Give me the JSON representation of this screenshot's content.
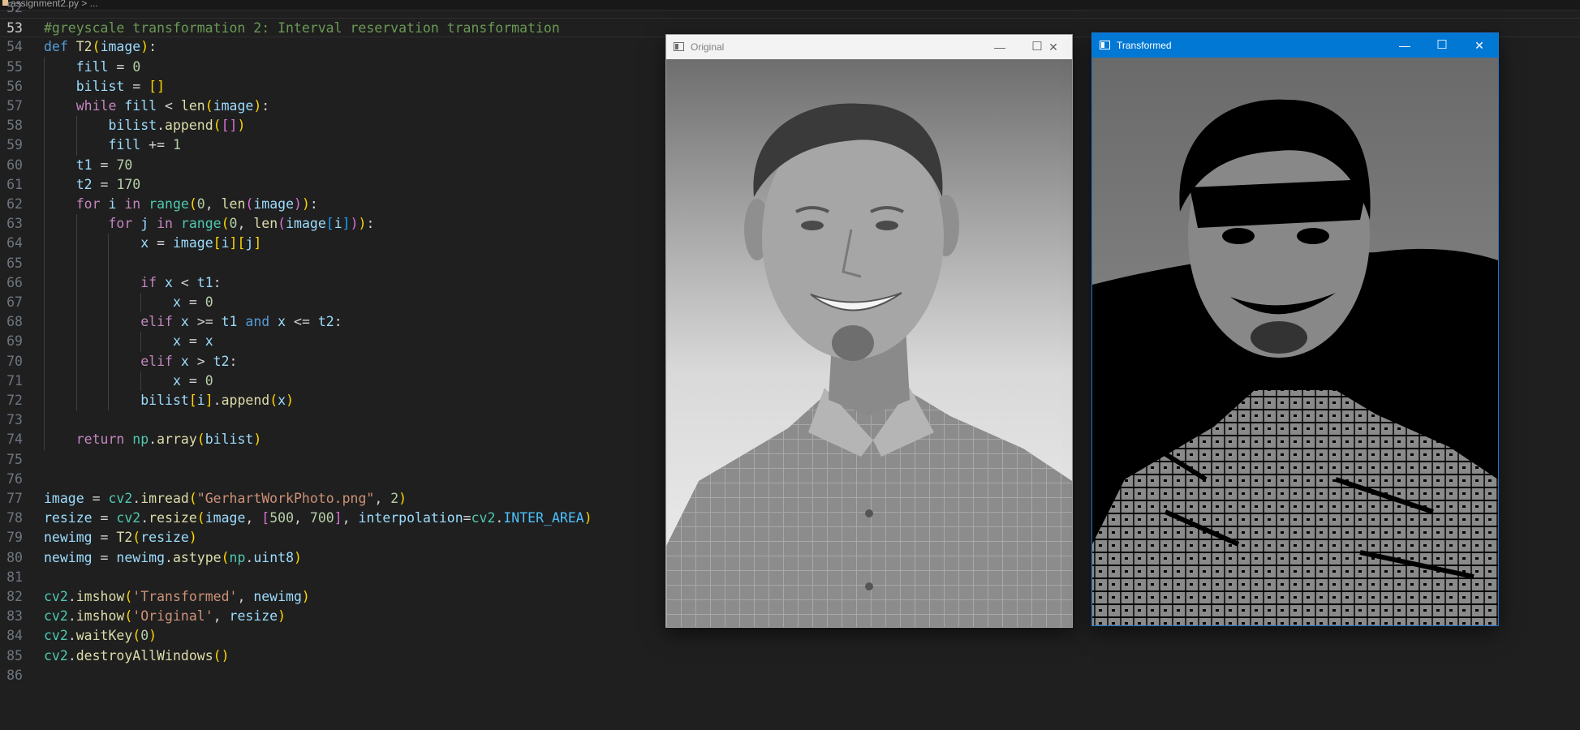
{
  "breadcrumb": {
    "file": "assignment2.py > ..."
  },
  "editor": {
    "current_line": "53",
    "lines": [
      {
        "n": "52",
        "tokens": []
      },
      {
        "n": "53",
        "tokens": [
          {
            "t": "#greyscale transformation 2: Interval reservation transformation",
            "c": "cm"
          }
        ]
      },
      {
        "n": "54",
        "tokens": [
          {
            "t": "def",
            "c": "kw"
          },
          {
            "t": " "
          },
          {
            "t": "T2",
            "c": "fn"
          },
          {
            "t": "(",
            "c": "b1"
          },
          {
            "t": "image",
            "c": "vr"
          },
          {
            "t": ")",
            "c": "b1"
          },
          {
            "t": ":"
          }
        ]
      },
      {
        "n": "55",
        "tokens": [
          {
            "t": "    "
          },
          {
            "t": "fill",
            "c": "vr"
          },
          {
            "t": " = "
          },
          {
            "t": "0",
            "c": "nm"
          }
        ]
      },
      {
        "n": "56",
        "tokens": [
          {
            "t": "    "
          },
          {
            "t": "bilist",
            "c": "vr"
          },
          {
            "t": " = "
          },
          {
            "t": "[]",
            "c": "b1"
          }
        ]
      },
      {
        "n": "57",
        "tokens": [
          {
            "t": "    "
          },
          {
            "t": "while",
            "c": "ctl"
          },
          {
            "t": " "
          },
          {
            "t": "fill",
            "c": "vr"
          },
          {
            "t": " < "
          },
          {
            "t": "len",
            "c": "fn"
          },
          {
            "t": "(",
            "c": "b1"
          },
          {
            "t": "image",
            "c": "vr"
          },
          {
            "t": ")",
            "c": "b1"
          },
          {
            "t": ":"
          }
        ]
      },
      {
        "n": "58",
        "tokens": [
          {
            "t": "        "
          },
          {
            "t": "bilist",
            "c": "vr"
          },
          {
            "t": "."
          },
          {
            "t": "append",
            "c": "fn"
          },
          {
            "t": "(",
            "c": "b1"
          },
          {
            "t": "[]",
            "c": "b2"
          },
          {
            "t": ")",
            "c": "b1"
          }
        ]
      },
      {
        "n": "59",
        "tokens": [
          {
            "t": "        "
          },
          {
            "t": "fill",
            "c": "vr"
          },
          {
            "t": " += "
          },
          {
            "t": "1",
            "c": "nm"
          }
        ]
      },
      {
        "n": "60",
        "tokens": [
          {
            "t": "    "
          },
          {
            "t": "t1",
            "c": "vr"
          },
          {
            "t": " = "
          },
          {
            "t": "70",
            "c": "nm"
          }
        ]
      },
      {
        "n": "61",
        "tokens": [
          {
            "t": "    "
          },
          {
            "t": "t2",
            "c": "vr"
          },
          {
            "t": " = "
          },
          {
            "t": "170",
            "c": "nm"
          }
        ]
      },
      {
        "n": "62",
        "tokens": [
          {
            "t": "    "
          },
          {
            "t": "for",
            "c": "ctl"
          },
          {
            "t": " "
          },
          {
            "t": "i",
            "c": "vr"
          },
          {
            "t": " "
          },
          {
            "t": "in",
            "c": "ctl"
          },
          {
            "t": " "
          },
          {
            "t": "range",
            "c": "md"
          },
          {
            "t": "(",
            "c": "b1"
          },
          {
            "t": "0",
            "c": "nm"
          },
          {
            "t": ", "
          },
          {
            "t": "len",
            "c": "fn"
          },
          {
            "t": "(",
            "c": "b2"
          },
          {
            "t": "image",
            "c": "vr"
          },
          {
            "t": ")",
            "c": "b2"
          },
          {
            "t": ")",
            "c": "b1"
          },
          {
            "t": ":"
          }
        ]
      },
      {
        "n": "63",
        "tokens": [
          {
            "t": "        "
          },
          {
            "t": "for",
            "c": "ctl"
          },
          {
            "t": " "
          },
          {
            "t": "j",
            "c": "vr"
          },
          {
            "t": " "
          },
          {
            "t": "in",
            "c": "ctl"
          },
          {
            "t": " "
          },
          {
            "t": "range",
            "c": "md"
          },
          {
            "t": "(",
            "c": "b1"
          },
          {
            "t": "0",
            "c": "nm"
          },
          {
            "t": ", "
          },
          {
            "t": "len",
            "c": "fn"
          },
          {
            "t": "(",
            "c": "b2"
          },
          {
            "t": "image",
            "c": "vr"
          },
          {
            "t": "[",
            "c": "b3"
          },
          {
            "t": "i",
            "c": "vr"
          },
          {
            "t": "]",
            "c": "b3"
          },
          {
            "t": ")",
            "c": "b2"
          },
          {
            "t": ")",
            "c": "b1"
          },
          {
            "t": ":"
          }
        ]
      },
      {
        "n": "64",
        "tokens": [
          {
            "t": "            "
          },
          {
            "t": "x",
            "c": "vr"
          },
          {
            "t": " = "
          },
          {
            "t": "image",
            "c": "vr"
          },
          {
            "t": "[",
            "c": "b1"
          },
          {
            "t": "i",
            "c": "vr"
          },
          {
            "t": "]",
            "c": "b1"
          },
          {
            "t": "[",
            "c": "b1"
          },
          {
            "t": "j",
            "c": "vr"
          },
          {
            "t": "]",
            "c": "b1"
          }
        ]
      },
      {
        "n": "65",
        "tokens": []
      },
      {
        "n": "66",
        "tokens": [
          {
            "t": "            "
          },
          {
            "t": "if",
            "c": "ctl"
          },
          {
            "t": " "
          },
          {
            "t": "x",
            "c": "vr"
          },
          {
            "t": " < "
          },
          {
            "t": "t1",
            "c": "vr"
          },
          {
            "t": ":"
          }
        ]
      },
      {
        "n": "67",
        "tokens": [
          {
            "t": "                "
          },
          {
            "t": "x",
            "c": "vr"
          },
          {
            "t": " = "
          },
          {
            "t": "0",
            "c": "nm"
          }
        ]
      },
      {
        "n": "68",
        "tokens": [
          {
            "t": "            "
          },
          {
            "t": "elif",
            "c": "ctl"
          },
          {
            "t": " "
          },
          {
            "t": "x",
            "c": "vr"
          },
          {
            "t": " >= "
          },
          {
            "t": "t1",
            "c": "vr"
          },
          {
            "t": " "
          },
          {
            "t": "and",
            "c": "kw"
          },
          {
            "t": " "
          },
          {
            "t": "x",
            "c": "vr"
          },
          {
            "t": " <= "
          },
          {
            "t": "t2",
            "c": "vr"
          },
          {
            "t": ":"
          }
        ]
      },
      {
        "n": "69",
        "tokens": [
          {
            "t": "                "
          },
          {
            "t": "x",
            "c": "vr"
          },
          {
            "t": " = "
          },
          {
            "t": "x",
            "c": "vr"
          }
        ]
      },
      {
        "n": "70",
        "tokens": [
          {
            "t": "            "
          },
          {
            "t": "elif",
            "c": "ctl"
          },
          {
            "t": " "
          },
          {
            "t": "x",
            "c": "vr"
          },
          {
            "t": " > "
          },
          {
            "t": "t2",
            "c": "vr"
          },
          {
            "t": ":"
          }
        ]
      },
      {
        "n": "71",
        "tokens": [
          {
            "t": "                "
          },
          {
            "t": "x",
            "c": "vr"
          },
          {
            "t": " = "
          },
          {
            "t": "0",
            "c": "nm"
          }
        ]
      },
      {
        "n": "72",
        "tokens": [
          {
            "t": "            "
          },
          {
            "t": "bilist",
            "c": "vr"
          },
          {
            "t": "[",
            "c": "b1"
          },
          {
            "t": "i",
            "c": "vr"
          },
          {
            "t": "]",
            "c": "b1"
          },
          {
            "t": "."
          },
          {
            "t": "append",
            "c": "fn"
          },
          {
            "t": "(",
            "c": "b1"
          },
          {
            "t": "x",
            "c": "vr"
          },
          {
            "t": ")",
            "c": "b1"
          }
        ]
      },
      {
        "n": "73",
        "tokens": []
      },
      {
        "n": "74",
        "tokens": [
          {
            "t": "    "
          },
          {
            "t": "return",
            "c": "ctl"
          },
          {
            "t": " "
          },
          {
            "t": "np",
            "c": "md"
          },
          {
            "t": "."
          },
          {
            "t": "array",
            "c": "fn"
          },
          {
            "t": "(",
            "c": "b1"
          },
          {
            "t": "bilist",
            "c": "vr"
          },
          {
            "t": ")",
            "c": "b1"
          }
        ]
      },
      {
        "n": "75",
        "tokens": []
      },
      {
        "n": "76",
        "tokens": []
      },
      {
        "n": "77",
        "tokens": [
          {
            "t": "image",
            "c": "vr"
          },
          {
            "t": " = "
          },
          {
            "t": "cv2",
            "c": "md"
          },
          {
            "t": "."
          },
          {
            "t": "imread",
            "c": "fn"
          },
          {
            "t": "(",
            "c": "b1"
          },
          {
            "t": "\"GerhartWorkPhoto.png\"",
            "c": "st"
          },
          {
            "t": ", "
          },
          {
            "t": "2",
            "c": "nm"
          },
          {
            "t": ")",
            "c": "b1"
          }
        ]
      },
      {
        "n": "78",
        "tokens": [
          {
            "t": "resize",
            "c": "vr"
          },
          {
            "t": " = "
          },
          {
            "t": "cv2",
            "c": "md"
          },
          {
            "t": "."
          },
          {
            "t": "resize",
            "c": "fn"
          },
          {
            "t": "(",
            "c": "b1"
          },
          {
            "t": "image",
            "c": "vr"
          },
          {
            "t": ", "
          },
          {
            "t": "[",
            "c": "b2"
          },
          {
            "t": "500",
            "c": "nm"
          },
          {
            "t": ", "
          },
          {
            "t": "700",
            "c": "nm"
          },
          {
            "t": "]",
            "c": "b2"
          },
          {
            "t": ", "
          },
          {
            "t": "interpolation",
            "c": "vr"
          },
          {
            "t": "="
          },
          {
            "t": "cv2",
            "c": "md"
          },
          {
            "t": "."
          },
          {
            "t": "INTER_AREA",
            "c": "cn"
          },
          {
            "t": ")",
            "c": "b1"
          }
        ]
      },
      {
        "n": "79",
        "tokens": [
          {
            "t": "newimg",
            "c": "vr"
          },
          {
            "t": " = "
          },
          {
            "t": "T2",
            "c": "fn"
          },
          {
            "t": "(",
            "c": "b1"
          },
          {
            "t": "resize",
            "c": "vr"
          },
          {
            "t": ")",
            "c": "b1"
          }
        ]
      },
      {
        "n": "80",
        "tokens": [
          {
            "t": "newimg",
            "c": "vr"
          },
          {
            "t": " = "
          },
          {
            "t": "newimg",
            "c": "vr"
          },
          {
            "t": "."
          },
          {
            "t": "astype",
            "c": "fn"
          },
          {
            "t": "(",
            "c": "b1"
          },
          {
            "t": "np",
            "c": "md"
          },
          {
            "t": "."
          },
          {
            "t": "uint8",
            "c": "vr"
          },
          {
            "t": ")",
            "c": "b1"
          }
        ]
      },
      {
        "n": "81",
        "tokens": []
      },
      {
        "n": "82",
        "tokens": [
          {
            "t": "cv2",
            "c": "md"
          },
          {
            "t": "."
          },
          {
            "t": "imshow",
            "c": "fn"
          },
          {
            "t": "(",
            "c": "b1"
          },
          {
            "t": "'Transformed'",
            "c": "st"
          },
          {
            "t": ", "
          },
          {
            "t": "newimg",
            "c": "vr"
          },
          {
            "t": ")",
            "c": "b1"
          }
        ]
      },
      {
        "n": "83",
        "tokens": [
          {
            "t": "cv2",
            "c": "md"
          },
          {
            "t": "."
          },
          {
            "t": "imshow",
            "c": "fn"
          },
          {
            "t": "(",
            "c": "b1"
          },
          {
            "t": "'Original'",
            "c": "st"
          },
          {
            "t": ", "
          },
          {
            "t": "resize",
            "c": "vr"
          },
          {
            "t": ")",
            "c": "b1"
          }
        ]
      },
      {
        "n": "84",
        "tokens": [
          {
            "t": "cv2",
            "c": "md"
          },
          {
            "t": "."
          },
          {
            "t": "waitKey",
            "c": "fn"
          },
          {
            "t": "(",
            "c": "b1"
          },
          {
            "t": "0",
            "c": "nm"
          },
          {
            "t": ")",
            "c": "b1"
          }
        ]
      },
      {
        "n": "85",
        "tokens": [
          {
            "t": "cv2",
            "c": "md"
          },
          {
            "t": "."
          },
          {
            "t": "destroyAllWindows",
            "c": "fn"
          },
          {
            "t": "()",
            "c": "b1"
          }
        ]
      },
      {
        "n": "86",
        "tokens": []
      }
    ]
  },
  "windows": {
    "original": {
      "title": "Original",
      "icons": [
        "app-icon",
        "minimize-icon",
        "maximize-icon",
        "close-icon"
      ]
    },
    "transformed": {
      "title": "Transformed",
      "icons": [
        "app-icon",
        "minimize-icon",
        "maximize-icon",
        "close-icon"
      ]
    }
  },
  "window_controls": {
    "minimize": "—",
    "maximize": "☐",
    "close": "✕"
  }
}
